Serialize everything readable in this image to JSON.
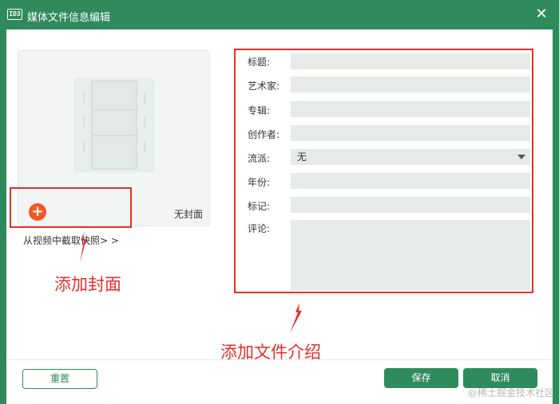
{
  "window": {
    "app_icon": "ID3",
    "title": "媒体文件信息编辑",
    "close": "✕"
  },
  "cover": {
    "no_cover_label": "无封面",
    "add_icon": "+",
    "snapshot_link": "从视频中截取快照> >"
  },
  "form": {
    "title_label": "标题:",
    "title_value": "",
    "artist_label": "艺术家:",
    "artist_value": "",
    "album_label": "专辑:",
    "album_value": "",
    "creator_label": "创作者:",
    "creator_value": "",
    "genre_label": "流派:",
    "genre_value": "无",
    "year_label": "年份:",
    "year_value": "",
    "tag_label": "标记:",
    "tag_value": "",
    "comment_label": "评论:",
    "comment_value": ""
  },
  "annotations": {
    "add_cover": "添加封面",
    "add_file_intro": "添加文件介绍"
  },
  "footer": {
    "reset": "重置",
    "save": "保存",
    "cancel": "取消"
  },
  "watermark": "@稀土掘金技术社区",
  "colors": {
    "primary": "#2f8a5c",
    "field_bg": "#e6ebe8",
    "annotation": "#e4302b",
    "add_button": "#f05a22"
  },
  "icons": {
    "cover_placeholder": "film-strip-icon",
    "add": "plus-circle-icon",
    "close": "close-icon",
    "genre_dropdown": "caret-down-icon"
  }
}
